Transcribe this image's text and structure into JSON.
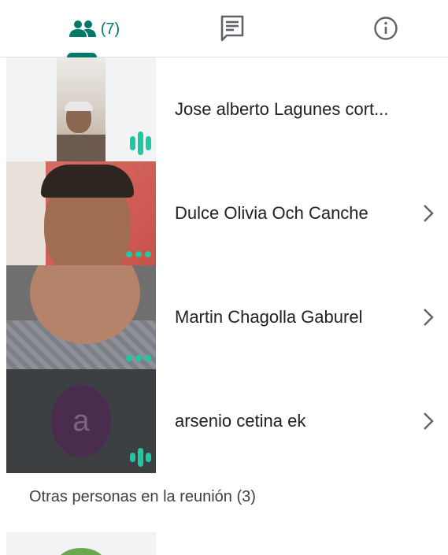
{
  "tabs": {
    "people_count": "(7)",
    "people_icon": "people-icon",
    "chat_icon": "chat-icon",
    "info_icon": "info-icon",
    "accent_color": "#00796b"
  },
  "participants": [
    {
      "name": "Jose alberto Lagunes cort...",
      "indicator": "speaking"
    },
    {
      "name": "Dulce Olivia Och Canche",
      "indicator": "dots"
    },
    {
      "name": "Martin Chagolla Gaburel",
      "indicator": "dots"
    },
    {
      "name": "arsenio cetina ek",
      "indicator": "speaking",
      "avatar_letter": "a"
    }
  ],
  "others": {
    "title": "Otras personas en la reunión (3)"
  }
}
